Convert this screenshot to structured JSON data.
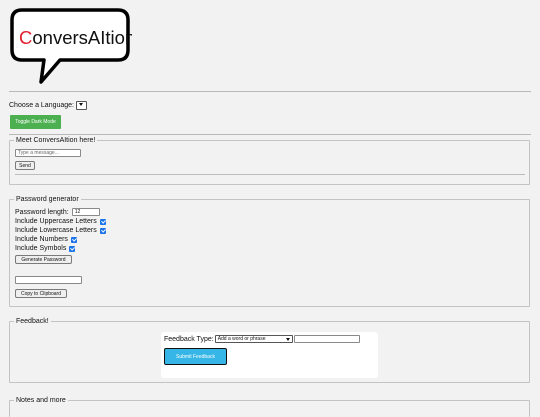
{
  "logo": {
    "first_letter": "C",
    "rest": "onversAItion"
  },
  "language": {
    "label": "Choose a Language:"
  },
  "dark_mode": {
    "label": "Toggle Dark Mode"
  },
  "chat": {
    "legend": "Meet ConversAItion here!",
    "placeholder": "Type a message...",
    "send_label": "Send"
  },
  "password": {
    "legend": "Password generator",
    "length_label": "Password length:",
    "length_value": "12",
    "uppercase_label": "Include Uppercase Letters",
    "lowercase_label": "Include Lowercase Letters",
    "numbers_label": "Include Numbers",
    "symbols_label": "Include Symbols",
    "generate_label": "Generate Password",
    "output_value": "",
    "copy_label": "Copy to Clipboard"
  },
  "feedback": {
    "legend": "Feedback!",
    "type_label": "Feedback Type:",
    "type_selected": "Add a word or phrase",
    "submit_label": "Submit Feedback"
  },
  "notes": {
    "legend": "Notes and more"
  },
  "colors": {
    "logo_red": "#e0202e",
    "green_button": "#4caf50",
    "blue_button": "#36b6e6",
    "checkbox": "#1a73e8"
  }
}
